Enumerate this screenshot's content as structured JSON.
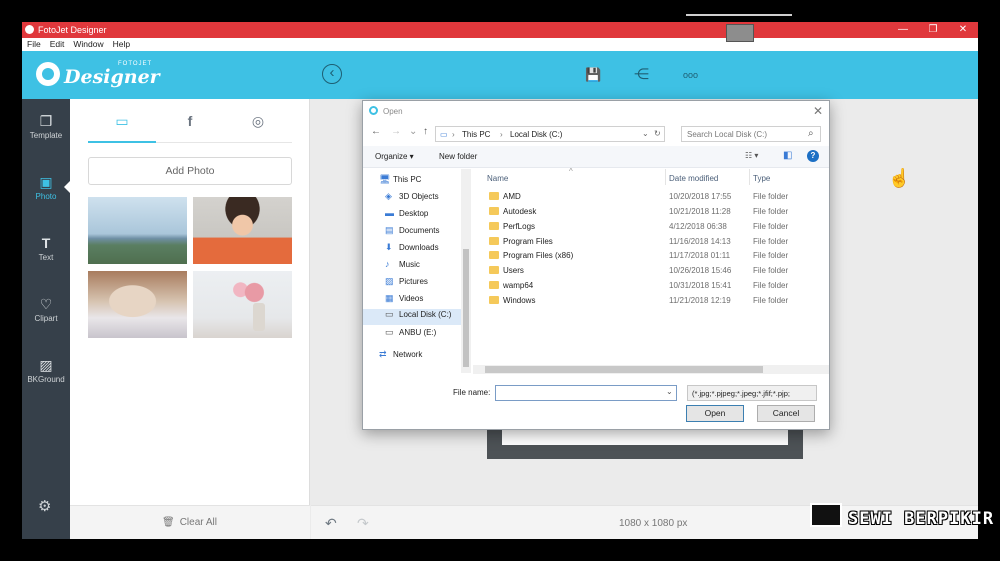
{
  "window": {
    "title": "FotoJet Designer",
    "minimize": "—",
    "maximize": "❐",
    "close": "✕"
  },
  "menu": [
    "File",
    "Edit",
    "Window",
    "Help"
  ],
  "header": {
    "logo_word": "Designer",
    "logo_brand": "FOTOJET",
    "back_icon": "‹",
    "save_icon": "💾",
    "share_icon": "⋲",
    "more_icon": "ooo"
  },
  "sidenav": [
    {
      "label": "Template",
      "icon": "❐"
    },
    {
      "label": "Photo",
      "icon": "▣"
    },
    {
      "label": "Text",
      "icon": "T"
    },
    {
      "label": "Clipart",
      "icon": "♡"
    },
    {
      "label": "BKGround",
      "icon": "▨"
    }
  ],
  "settings_icon": "⚙",
  "panel": {
    "tabs": [
      {
        "icon": "▭"
      },
      {
        "icon": "f"
      },
      {
        "icon": "◎"
      }
    ],
    "add_photo": "Add Photo",
    "clear_all": "Clear All",
    "clear_icon": "🗑"
  },
  "canvas": {
    "size": "1080 x 1080 px",
    "undo": "↶",
    "redo": "↷"
  },
  "dialog": {
    "title": "Open",
    "close": "✕",
    "back": "←",
    "forward": "→",
    "recent": "⌄",
    "up": "↑",
    "path": [
      "This PC",
      "Local Disk (C:)"
    ],
    "refresh": "↻",
    "search_placeholder": "Search Local Disk (C:)",
    "search_icon": "⌕",
    "organize": "Organize ▾",
    "new_folder": "New folder",
    "view_icon": "☷ ▾",
    "pane_icon": "◧",
    "help_icon": "?",
    "tree": [
      {
        "label": "This PC",
        "icon": "🖥"
      },
      {
        "label": "3D Objects",
        "icon": "◈"
      },
      {
        "label": "Desktop",
        "icon": "▬"
      },
      {
        "label": "Documents",
        "icon": "▤"
      },
      {
        "label": "Downloads",
        "icon": "⬇"
      },
      {
        "label": "Music",
        "icon": "♪"
      },
      {
        "label": "Pictures",
        "icon": "▨"
      },
      {
        "label": "Videos",
        "icon": "▦"
      },
      {
        "label": "Local Disk (C:)",
        "icon": "▭"
      },
      {
        "label": "ANBU (E:)",
        "icon": "▭"
      },
      {
        "label": "Network",
        "icon": "⇄"
      }
    ],
    "columns": {
      "name": "Name",
      "date": "Date modified",
      "type": "Type"
    },
    "files": [
      {
        "name": "AMD",
        "date": "10/20/2018 17:55",
        "type": "File folder"
      },
      {
        "name": "Autodesk",
        "date": "10/21/2018 11:28",
        "type": "File folder"
      },
      {
        "name": "PerfLogs",
        "date": "4/12/2018 06:38",
        "type": "File folder"
      },
      {
        "name": "Program Files",
        "date": "11/16/2018 14:13",
        "type": "File folder"
      },
      {
        "name": "Program Files (x86)",
        "date": "11/17/2018 01:11",
        "type": "File folder"
      },
      {
        "name": "Users",
        "date": "10/26/2018 15:46",
        "type": "File folder"
      },
      {
        "name": "wamp64",
        "date": "10/31/2018 15:41",
        "type": "File folder"
      },
      {
        "name": "Windows",
        "date": "11/21/2018 12:19",
        "type": "File folder"
      }
    ],
    "file_name_label": "File name:",
    "file_name_value": "",
    "file_type": "(*.jpg;*.pjpeg;*.jpeg;*.jfif;*.pjp;",
    "open_button": "Open",
    "cancel_button": "Cancel"
  },
  "watermark": "SEWI BERPIKIR"
}
